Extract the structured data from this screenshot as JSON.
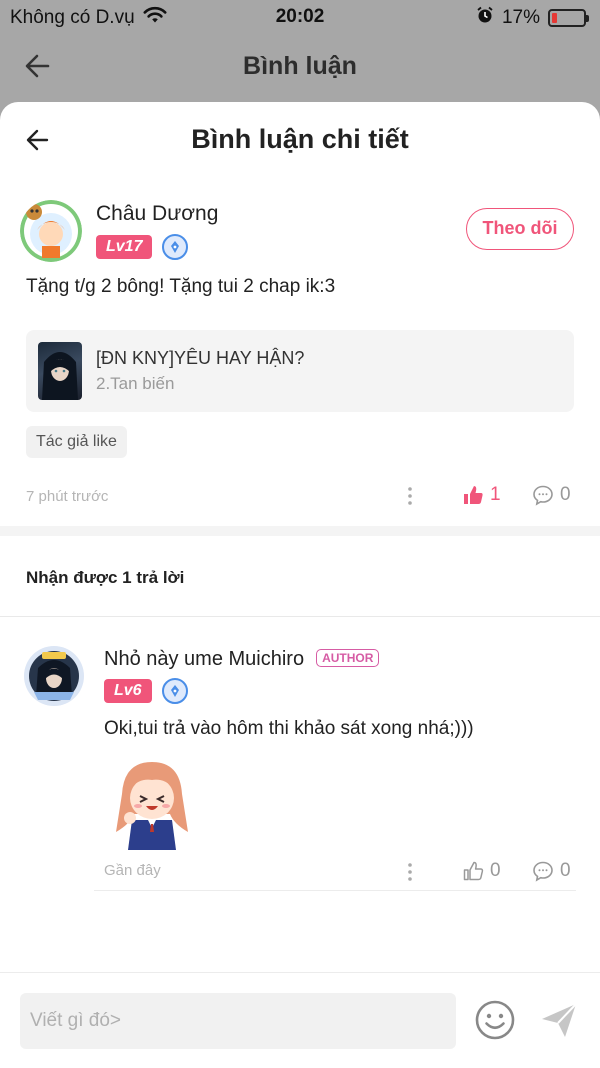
{
  "status_bar": {
    "carrier": "Không có D.vụ",
    "time": "20:02",
    "battery": "17%",
    "battery_level": 0.17
  },
  "background_header": {
    "title": "Bình luận"
  },
  "sheet": {
    "title": "Bình luận chi tiết"
  },
  "comment": {
    "user_name": "Châu Dương",
    "level": "Lv17",
    "follow_label": "Theo dõi",
    "text": "Tặng t/g 2 bông! Tặng tui 2 chap ik:3",
    "story": {
      "title": "[ĐN KNY]YÊU HAY HẬN?",
      "chapter": "2.Tan biến"
    },
    "tag": "Tác giả like",
    "time": "7 phút trước",
    "likes": "1",
    "replies": "0"
  },
  "replies_header": "Nhận được 1 trả lời",
  "reply": {
    "user_name": "Nhỏ này ume Muichiro",
    "author_badge": "AUTHOR",
    "level": "Lv6",
    "text": "Oki,tui trả vào hôm thi khảo sát xong nhá;)))",
    "time": "Gần đây",
    "likes": "0",
    "replies": "0"
  },
  "input": {
    "placeholder": "Viết gì đó>"
  },
  "colors": {
    "accent": "#f0557a",
    "author": "#d65ca4",
    "verify": "#4a8ee8"
  }
}
